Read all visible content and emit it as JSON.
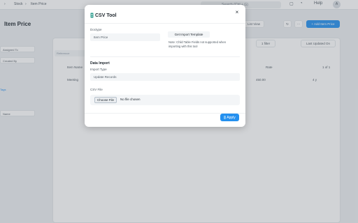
{
  "navbar": {
    "breadcrumbs": [
      "Stock",
      "Item Price"
    ],
    "search_hint": "Search (Ctrl + G)",
    "help_label": "Help",
    "avatar_initial": "A"
  },
  "page": {
    "title": "Item Price",
    "side_filters": [
      "Assigned To",
      "Created By"
    ],
    "side_tags_label": "Tags",
    "side_name_placeholder": "Name",
    "list_view_label": "List View",
    "add_button": "+ Add Item Price",
    "filter_button": "1 filter",
    "sort_button": "Last Updated On",
    "reference_placeholder": "Reference",
    "column_item_name": "Item Name",
    "column_rate": "Rate",
    "pagination": "1 of 1",
    "row_item": "Meeting",
    "row_rate": "450.00",
    "row_age": "4 y"
  },
  "modal": {
    "title": "CSV Tool",
    "close_glyph": "×",
    "doctype_label": "Doctype",
    "doctype_value": "Item Price",
    "get_template_label": "Get Import Template",
    "note": "Note: Child Table Fields not supported when importing with this tool",
    "section_title": "Data Import",
    "import_type_label": "Import Type",
    "import_type_value": "Update Records",
    "csv_file_label": "CSV File",
    "choose_file_label": "Choose File",
    "no_file_label": "No file chosen",
    "apply_label": "Apply"
  },
  "icons": {
    "close": "close-icon",
    "csv": "csv-file-icon",
    "apply": "csv-file-icon"
  },
  "colors": {
    "primary": "#2490ef",
    "csv_icon": "#2a9b8c"
  }
}
